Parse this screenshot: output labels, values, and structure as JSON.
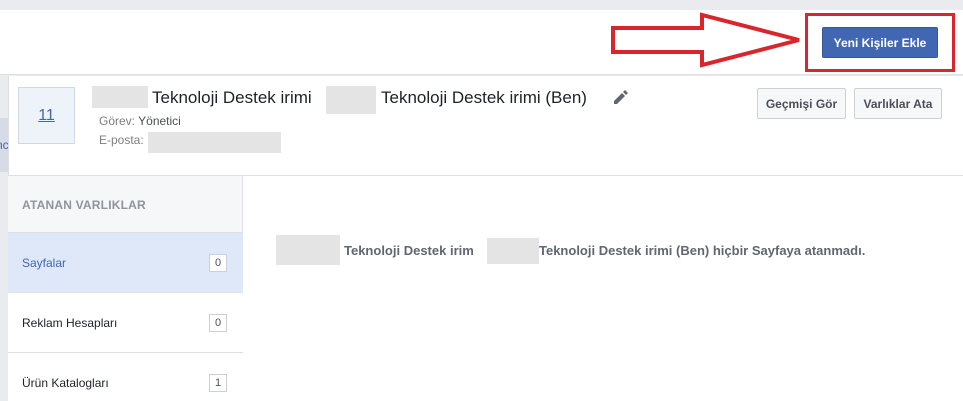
{
  "toolbar": {
    "add_people_label": "Yeni Kişiler Ekle"
  },
  "left_edge": {
    "fragment": "nc"
  },
  "person": {
    "avatar_text": "11",
    "name_part1": "Teknoloji Destek irimi",
    "name_part2": "Teknoloji Destek irimi (Ben)",
    "role_label": "Görev:",
    "role_value": "Yönetici",
    "email_label": "E-posta:"
  },
  "actions": {
    "view_history": "Geçmişi Gör",
    "assign_assets": "Varlıklar Ata"
  },
  "sidebar": {
    "heading": "ATANAN VARLIKLAR",
    "items": [
      {
        "label": "Sayfalar",
        "count": "0"
      },
      {
        "label": "Reklam Hesapları",
        "count": "0"
      },
      {
        "label": "Ürün Katalogları",
        "count": "1"
      }
    ]
  },
  "main": {
    "empty_part1": "Teknoloji Destek irim",
    "empty_part2": "Teknoloji Destek irimi (Ben) hiçbir Sayfaya atanmadı."
  },
  "colors": {
    "primary": "#4267b2",
    "annotation_red": "#d9262c"
  },
  "icons": [
    "pencil-icon",
    "right-arrow-icon"
  ]
}
